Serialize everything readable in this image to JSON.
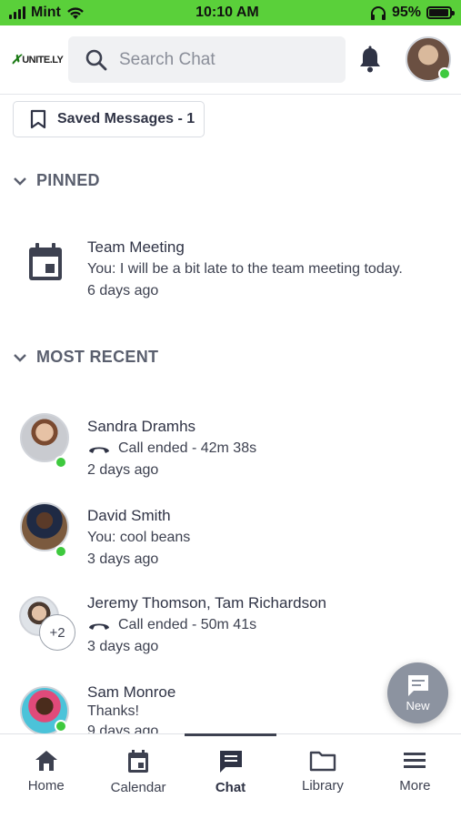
{
  "status_bar": {
    "carrier": "Mint",
    "time": "10:10 AM",
    "battery": "95%",
    "battery_level": 0.95
  },
  "header": {
    "logo_text": "UNITE.LY",
    "search_placeholder": "Search Chat",
    "icons": {
      "search": "search-icon",
      "bell": "bell-icon"
    }
  },
  "saved": {
    "label": "Saved Messages - 1"
  },
  "sections": {
    "pinned": "PINNED",
    "recent": "MOST RECENT"
  },
  "pinned": [
    {
      "name": "Team Meeting",
      "message": "You: I will be a bit late to the team meeting today.",
      "time": "6 days ago"
    }
  ],
  "recent": [
    {
      "name": "Sandra Dramhs",
      "message": "Call ended - 42m 38s",
      "call": true,
      "time": "2 days ago",
      "online": true
    },
    {
      "name": "David Smith",
      "message": "You: cool beans",
      "call": false,
      "time": "3 days ago",
      "online": true
    },
    {
      "name": "Jeremy Thomson, Tam Richardson",
      "message": "Call ended - 50m 41s",
      "call": true,
      "time": "3 days ago",
      "extra": "+2"
    },
    {
      "name": "Sam Monroe",
      "message": "Thanks!",
      "call": false,
      "time": "9 days ago",
      "online": true
    }
  ],
  "fab": {
    "label": "New"
  },
  "nav": [
    {
      "label": "Home",
      "icon": "home-icon"
    },
    {
      "label": "Calendar",
      "icon": "calendar-icon"
    },
    {
      "label": "Chat",
      "icon": "chat-icon",
      "active": true
    },
    {
      "label": "Library",
      "icon": "folder-icon"
    },
    {
      "label": "More",
      "icon": "menu-icon"
    }
  ],
  "colors": {
    "status_green": "#5ad03a",
    "online": "#3ec93e",
    "text": "#2f3345"
  }
}
